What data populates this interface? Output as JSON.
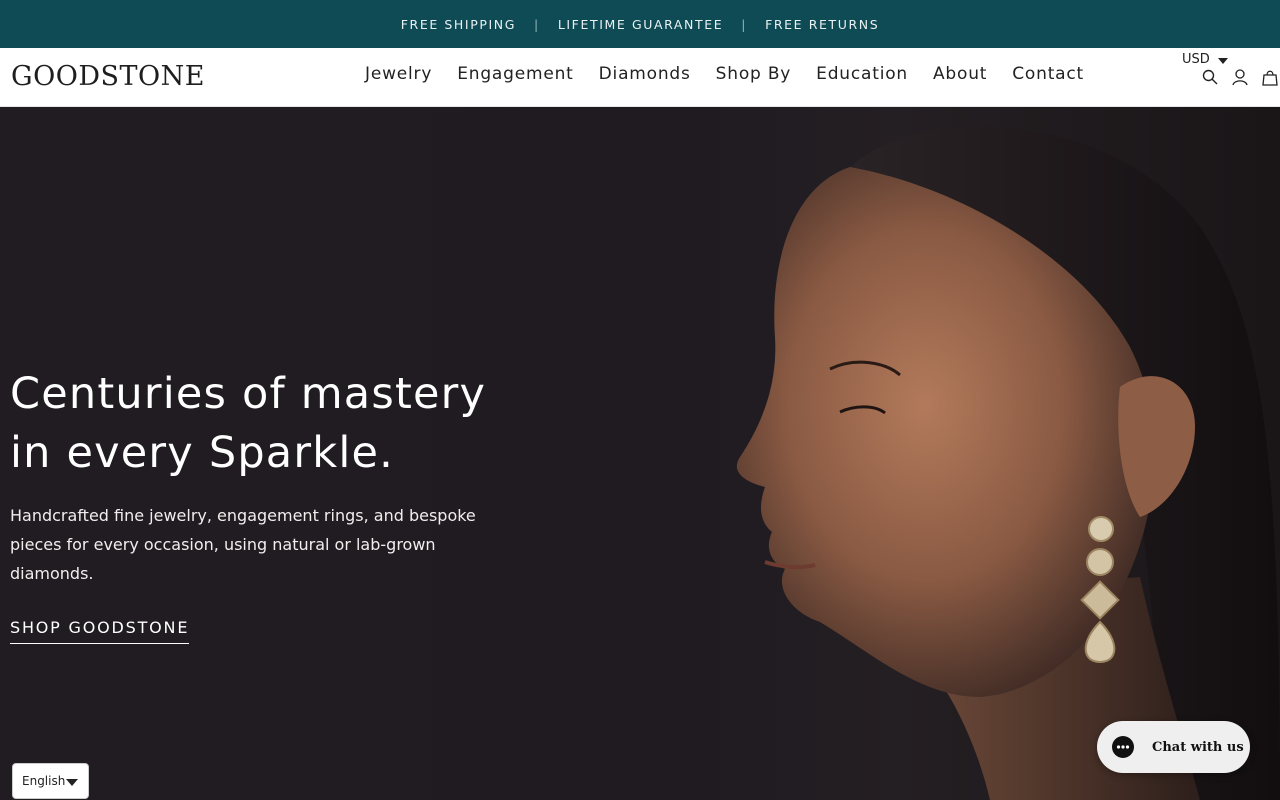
{
  "announcement": {
    "items": [
      "FREE SHIPPING",
      "LIFETIME GUARANTEE",
      "FREE RETURNS"
    ],
    "separator": "|",
    "bg_color": "#0f4b55"
  },
  "header": {
    "logo": "GOODSTONE",
    "nav": [
      {
        "label": "Jewelry"
      },
      {
        "label": "Engagement"
      },
      {
        "label": "Diamonds"
      },
      {
        "label": "Shop By"
      },
      {
        "label": "Education"
      },
      {
        "label": "About"
      },
      {
        "label": "Contact"
      }
    ],
    "currency": "USD",
    "icons": [
      "search-icon",
      "account-icon",
      "cart-icon"
    ]
  },
  "hero": {
    "headline_line1": "Centuries of mastery",
    "headline_line2": "in every Sparkle.",
    "subcopy": "Handcrafted fine jewelry, engagement rings, and bespoke pieces for every occasion, using natural or lab-grown diamonds.",
    "cta": "SHOP GOODSTONE"
  },
  "chat": {
    "label": "Chat with us",
    "icon": "chat-bubble-icon"
  },
  "language": {
    "selected": "English"
  }
}
